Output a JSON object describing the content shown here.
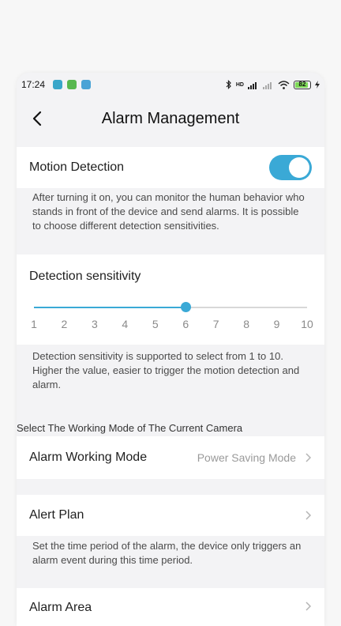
{
  "status": {
    "time": "17:24",
    "network": "HD",
    "battery": "82",
    "icon_colors": [
      "#39a6c9",
      "#58b84f",
      "#4aa3d6"
    ]
  },
  "header": {
    "title": "Alarm Management"
  },
  "motion": {
    "label": "Motion Detection",
    "enabled": true,
    "description": "After turning it on, you can monitor the human behavior who stands in front of the device and send alarms. It is possible to choose different detection sensitivities."
  },
  "sensitivity": {
    "label": "Detection sensitivity",
    "value": 6,
    "min": 1,
    "max": 10,
    "ticks": [
      "1",
      "2",
      "3",
      "4",
      "5",
      "6",
      "7",
      "8",
      "9",
      "10"
    ],
    "description": "Detection sensitivity is supported to select from 1 to 10. Higher the value, easier to trigger the motion detection and alarm."
  },
  "working_mode": {
    "caption": "Select The Working Mode of The Current Camera",
    "label": "Alarm Working Mode",
    "value": "Power Saving Mode"
  },
  "alert_plan": {
    "label": "Alert Plan",
    "description": "Set the time period of the alarm, the device only triggers an alarm event during this time period."
  },
  "alarm_area": {
    "label": "Alarm Area"
  },
  "colors": {
    "accent": "#3aa9d6",
    "battery_green": "#7ed957"
  }
}
